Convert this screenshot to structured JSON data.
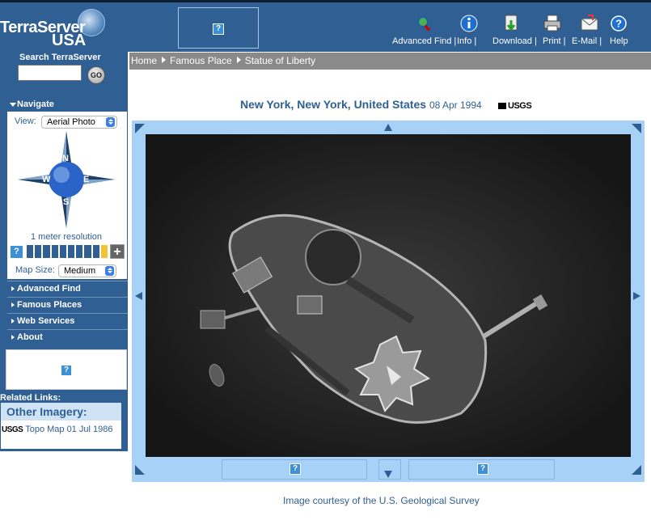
{
  "header": {
    "logo": {
      "line1": "TerraServer",
      "line2": "USA",
      "arc_text": "TERRASERVER USA"
    },
    "toolbar": [
      {
        "label": "Advanced Find |",
        "icon": "magnifier-globe-icon"
      },
      {
        "label": "Info |",
        "icon": "info-icon"
      },
      {
        "label": "Download |",
        "icon": "download-icon"
      },
      {
        "label": "Print |",
        "icon": "printer-icon"
      },
      {
        "label": "E-Mail |",
        "icon": "mail-icon"
      },
      {
        "label": "Help",
        "icon": "help-icon"
      }
    ]
  },
  "search": {
    "title": "Search TerraServer",
    "value": "",
    "go_label": "GO"
  },
  "breadcrumb": [
    "Home",
    "Famous Place",
    "Statue of Liberty"
  ],
  "navigate": {
    "title": "Navigate",
    "view_label": "View:",
    "view_value": "Aerial Photo",
    "compass": {
      "n": "N",
      "s": "S",
      "e": "E",
      "w": "W"
    },
    "resolution": "1 meter resolution",
    "zoom_level_of_10": 9,
    "map_size_label": "Map Size:",
    "map_size_value": "Medium"
  },
  "side_links": [
    "Advanced Find",
    "Famous Places",
    "Web Services",
    "About"
  ],
  "related": {
    "title": "Related Links:",
    "heading": "Other Imagery:",
    "item_brand": "USGS",
    "item_link": "Topo Map 01 Jul 1986"
  },
  "main": {
    "place": "New York, New York, United States",
    "date": "08 Apr 1994",
    "provider_logo": "USGS",
    "courtesy": "Image courtesy of the U.S. Geological Survey"
  },
  "colors": {
    "brand": "#2f5f93",
    "frame": "#a7d1f7",
    "breadcrumb_bg": "#8a8a8a",
    "zoom_active": "#f4c430"
  }
}
